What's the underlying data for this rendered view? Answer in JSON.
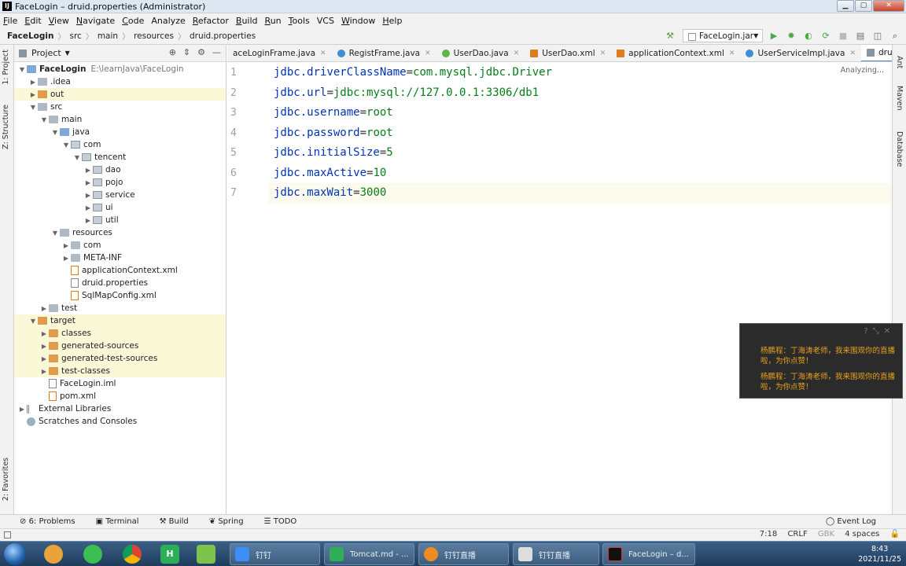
{
  "window": {
    "title": "FaceLogin – druid.properties (Administrator)",
    "app_icon": "intellij-icon",
    "controls": [
      "minimize",
      "maximize",
      "close"
    ]
  },
  "menu": [
    {
      "u": "F",
      "rest": "ile"
    },
    {
      "u": "E",
      "rest": "dit"
    },
    {
      "u": "V",
      "rest": "iew"
    },
    {
      "u": "N",
      "rest": "avigate"
    },
    {
      "u": "C",
      "rest": "ode"
    },
    {
      "u": "",
      "rest": "Analyze"
    },
    {
      "u": "R",
      "rest": "efactor"
    },
    {
      "u": "B",
      "rest": "uild"
    },
    {
      "u": "R",
      "rest": "un"
    },
    {
      "u": "T",
      "rest": "ools"
    },
    {
      "u": "",
      "rest": "VCS"
    },
    {
      "u": "W",
      "rest": "indow"
    },
    {
      "u": "H",
      "rest": "elp"
    }
  ],
  "breadcrumb": [
    "FaceLogin",
    "src",
    "main",
    "resources",
    "druid.properties"
  ],
  "run_config": "FaceLogin.jar",
  "left_strip": [
    "1: Project",
    "Z: Structure",
    "2: Favorites"
  ],
  "right_strip": [
    "Ant",
    "Maven",
    "Database"
  ],
  "project": {
    "title": "Project",
    "tree": [
      {
        "label": "FaceLogin",
        "path": "E:\\learnJava\\FaceLogin",
        "depth": 0,
        "arrow": "down",
        "icon": "folder-b",
        "bold": true
      },
      {
        "label": ".idea",
        "depth": 1,
        "arrow": "right",
        "icon": "folder"
      },
      {
        "label": "out",
        "depth": 1,
        "arrow": "right",
        "icon": "folder-o",
        "hl": true
      },
      {
        "label": "src",
        "depth": 1,
        "arrow": "down",
        "icon": "folder"
      },
      {
        "label": "main",
        "depth": 2,
        "arrow": "down",
        "icon": "folder"
      },
      {
        "label": "java",
        "depth": 3,
        "arrow": "down",
        "icon": "folder-b"
      },
      {
        "label": "com",
        "depth": 4,
        "arrow": "down",
        "icon": "pkg"
      },
      {
        "label": "tencent",
        "depth": 5,
        "arrow": "down",
        "icon": "pkg"
      },
      {
        "label": "dao",
        "depth": 6,
        "arrow": "right",
        "icon": "pkg"
      },
      {
        "label": "pojo",
        "depth": 6,
        "arrow": "right",
        "icon": "pkg"
      },
      {
        "label": "service",
        "depth": 6,
        "arrow": "right",
        "icon": "pkg"
      },
      {
        "label": "ui",
        "depth": 6,
        "arrow": "right",
        "icon": "pkg"
      },
      {
        "label": "util",
        "depth": 6,
        "arrow": "right",
        "icon": "pkg"
      },
      {
        "label": "resources",
        "depth": 3,
        "arrow": "down",
        "icon": "folder"
      },
      {
        "label": "com",
        "depth": 4,
        "arrow": "right",
        "icon": "folder"
      },
      {
        "label": "META-INF",
        "depth": 4,
        "arrow": "right",
        "icon": "folder"
      },
      {
        "label": "applicationContext.xml",
        "depth": 4,
        "arrow": "",
        "icon": "xml"
      },
      {
        "label": "druid.properties",
        "depth": 4,
        "arrow": "",
        "icon": "file"
      },
      {
        "label": "SqlMapConfig.xml",
        "depth": 4,
        "arrow": "",
        "icon": "xml"
      },
      {
        "label": "test",
        "depth": 2,
        "arrow": "right",
        "icon": "folder"
      },
      {
        "label": "target",
        "depth": 1,
        "arrow": "down",
        "icon": "folder-o",
        "hl": true
      },
      {
        "label": "classes",
        "depth": 2,
        "arrow": "right",
        "icon": "folder-o",
        "hl": true
      },
      {
        "label": "generated-sources",
        "depth": 2,
        "arrow": "right",
        "icon": "folder-o",
        "hl": true
      },
      {
        "label": "generated-test-sources",
        "depth": 2,
        "arrow": "right",
        "icon": "folder-o",
        "hl": true
      },
      {
        "label": "test-classes",
        "depth": 2,
        "arrow": "right",
        "icon": "folder-o",
        "hl": true
      },
      {
        "label": "FaceLogin.iml",
        "depth": 2,
        "arrow": "",
        "icon": "file"
      },
      {
        "label": "pom.xml",
        "depth": 2,
        "arrow": "",
        "icon": "xml"
      },
      {
        "label": "External Libraries",
        "depth": 0,
        "arrow": "right",
        "icon": "lib"
      },
      {
        "label": "Scratches and Consoles",
        "depth": 0,
        "arrow": "",
        "icon": "scratch"
      }
    ]
  },
  "tabs": [
    {
      "label": "aceLoginFrame.java",
      "icon": "",
      "color": ""
    },
    {
      "label": "RegistFrame.java",
      "icon": "class",
      "color": "#3d8fd6"
    },
    {
      "label": "UserDao.java",
      "icon": "interface",
      "color": "#62b543"
    },
    {
      "label": "UserDao.xml",
      "icon": "xml",
      "color": "#e07b20"
    },
    {
      "label": "applicationContext.xml",
      "icon": "xml",
      "color": "#e07b20"
    },
    {
      "label": "UserServiceImpl.java",
      "icon": "class",
      "color": "#3d8fd6"
    },
    {
      "label": "druid.properties",
      "icon": "properties",
      "color": "#8a95a2",
      "active": true
    }
  ],
  "analyzing": "Analyzing...",
  "code": [
    {
      "key": "jdbc.driverClassName",
      "value": "com.mysql.jdbc.Driver"
    },
    {
      "key": "jdbc.url",
      "value": "jdbc:mysql://127.0.0.1:3306/db1"
    },
    {
      "key": "jdbc.username",
      "value": "root"
    },
    {
      "key": "jdbc.password",
      "value": "root"
    },
    {
      "key": "jdbc.initialSize",
      "value": "5"
    },
    {
      "key": "jdbc.maxActive",
      "value": "10"
    },
    {
      "key": "jdbc.maxWait",
      "value": "3000"
    }
  ],
  "line_numbers": [
    "1",
    "2",
    "3",
    "4",
    "5",
    "6",
    "7"
  ],
  "notification": {
    "messages": [
      "杨鹏程：丁海涛老师，我来围观你的直播啦，为你点赞！",
      "杨鹏程：丁海涛老师，我来围观你的直播啦，为你点赞！"
    ]
  },
  "bottom_tools": [
    "6: Problems",
    "Terminal",
    "Build",
    "Spring",
    "TODO"
  ],
  "event_log": "Event Log",
  "status": {
    "position": "7:18",
    "line_sep": "CRLF",
    "encoding": "GBK",
    "indent": "4 spaces"
  },
  "taskbar": {
    "tasks": [
      "钉钉",
      "Tomcat.md - ...",
      "钉钉直播",
      "钉钉直播",
      "FaceLogin – d..."
    ],
    "time": "8:43",
    "date": "2021/11/25"
  }
}
